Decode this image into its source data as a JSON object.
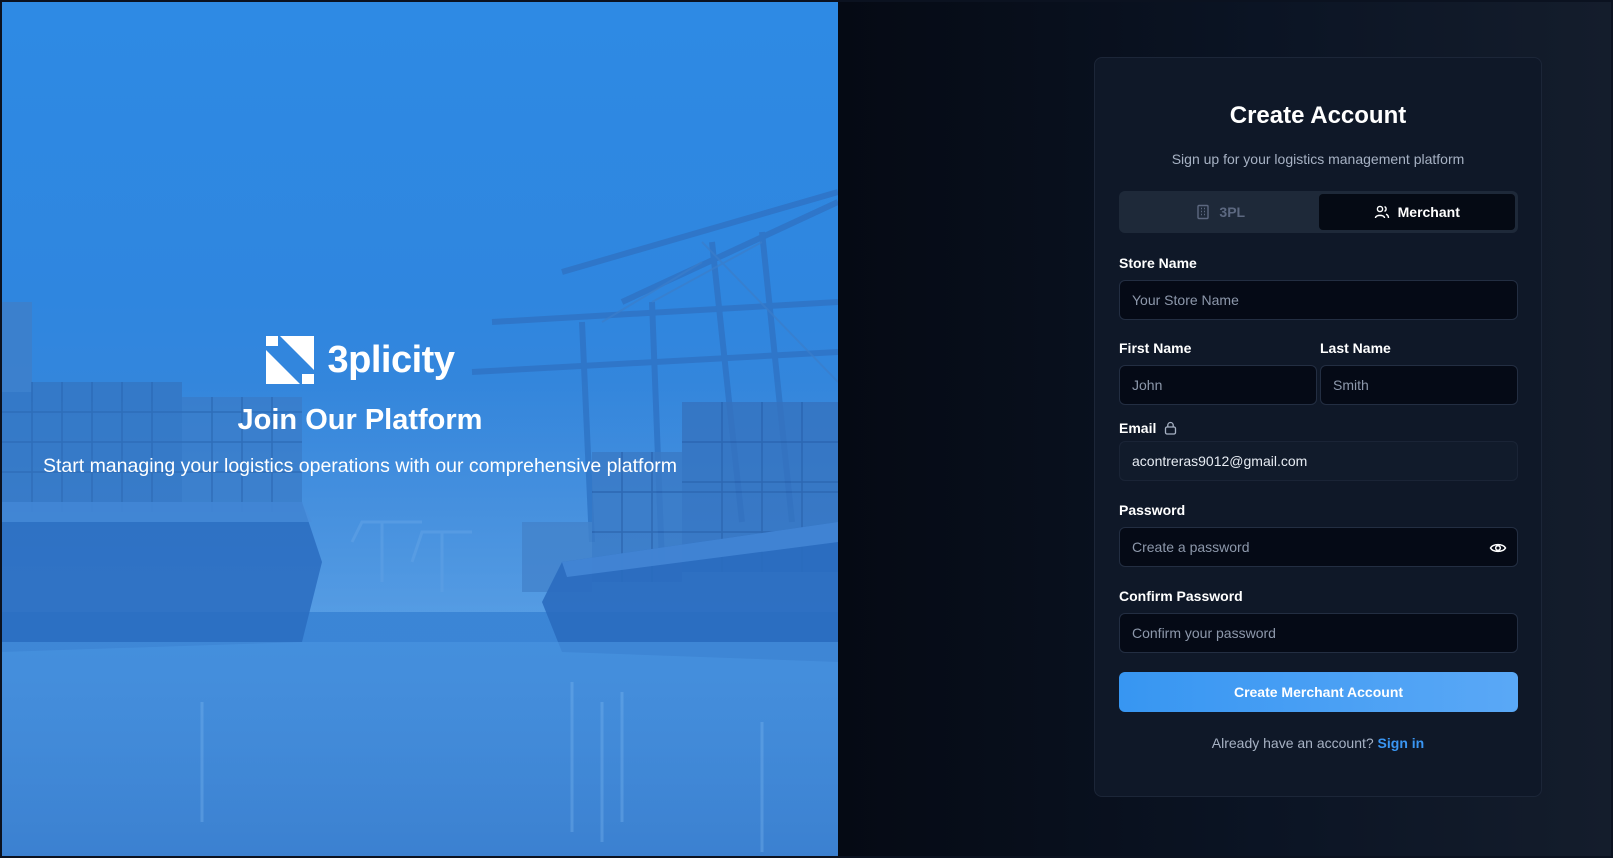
{
  "hero": {
    "brand_name": "3plicity",
    "title": "Join Our Platform",
    "subtitle": "Start managing your logistics operations with our comprehensive platform"
  },
  "card": {
    "title": "Create Account",
    "subtitle": "Sign up for your logistics management platform",
    "account_types": [
      {
        "label": "3PL",
        "icon": "building-icon",
        "active": false
      },
      {
        "label": "Merchant",
        "icon": "users-icon",
        "active": true
      }
    ],
    "fields": {
      "store_name": {
        "label": "Store Name",
        "placeholder": "Your Store Name",
        "value": ""
      },
      "first_name": {
        "label": "First Name",
        "placeholder": "John",
        "value": ""
      },
      "last_name": {
        "label": "Last Name",
        "placeholder": "Smith",
        "value": ""
      },
      "email": {
        "label": "Email",
        "value": "acontreras9012@gmail.com",
        "icon": "lock-icon"
      },
      "password": {
        "label": "Password",
        "placeholder": "Create a password",
        "value": "",
        "icon": "eye-icon"
      },
      "confirm_password": {
        "label": "Confirm Password",
        "placeholder": "Confirm your password",
        "value": ""
      }
    },
    "submit_label": "Create Merchant Account",
    "footer_text": "Already have an account?",
    "signin_label": "Sign in"
  },
  "colors": {
    "accent": "#3a96f3",
    "hero_blue": "#2f86df",
    "card_bg": "#0f1828"
  }
}
